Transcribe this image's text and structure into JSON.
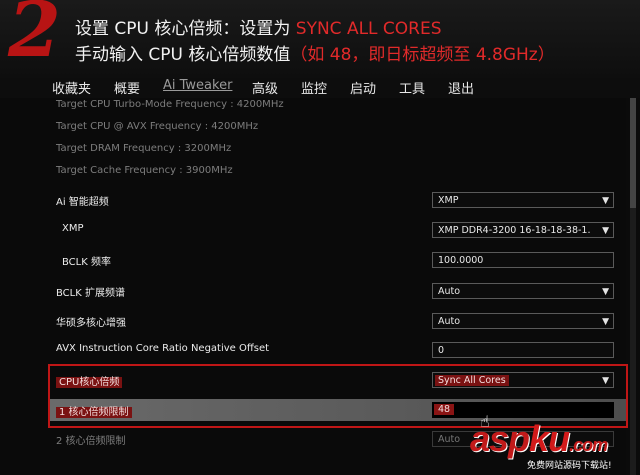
{
  "header": {
    "step_number": "2",
    "line1_prefix": "设置 CPU 核心倍频：设置为 ",
    "line1_highlight": "SYNC ALL CORES",
    "line2_prefix": "手动输入 CPU 核心倍频数值",
    "line2_highlight": "（如 48，即日标超频至 4.8GHz）"
  },
  "menu": {
    "items": [
      "收藏夹",
      "概要",
      "Ai Tweaker",
      "高级",
      "监控",
      "启动",
      "工具",
      "退出"
    ],
    "active_index": 2
  },
  "info_rows": [
    "Target CPU Turbo-Mode Frequency : 4200MHz",
    "Target CPU @ AVX Frequency : 4200MHz",
    "Target DRAM Frequency : 3200MHz",
    "Target Cache Frequency : 3900MHz"
  ],
  "settings": [
    {
      "label": "Ai 智能超频",
      "value": "XMP",
      "dropdown": true
    },
    {
      "label": "XMP",
      "value": "XMP DDR4-3200 16-18-18-38-1.",
      "dropdown": true
    },
    {
      "label": "BCLK 频率",
      "value": "100.0000",
      "dropdown": false
    },
    {
      "label": "BCLK 扩展频谱",
      "value": "Auto",
      "dropdown": true
    },
    {
      "label": "华硕多核心增强",
      "value": "Auto",
      "dropdown": true
    },
    {
      "label": "AVX Instruction Core Ratio Negative Offset",
      "value": "0",
      "dropdown": false
    }
  ],
  "cpu_ratio": {
    "label": "CPU核心倍频",
    "value": "Sync All Cores"
  },
  "core1_limit": {
    "label": "1 核心倍频限制",
    "value": "48"
  },
  "core2_limit": {
    "label": "2 核心倍频限制",
    "value": "Auto"
  },
  "watermark": {
    "brand_a": "asp",
    "brand_b": "ku",
    "dot": ".com",
    "sub": "免费网站源码下载站!"
  },
  "colors": {
    "accent_red": "#c01616",
    "banner_red": "#e12a2a"
  }
}
